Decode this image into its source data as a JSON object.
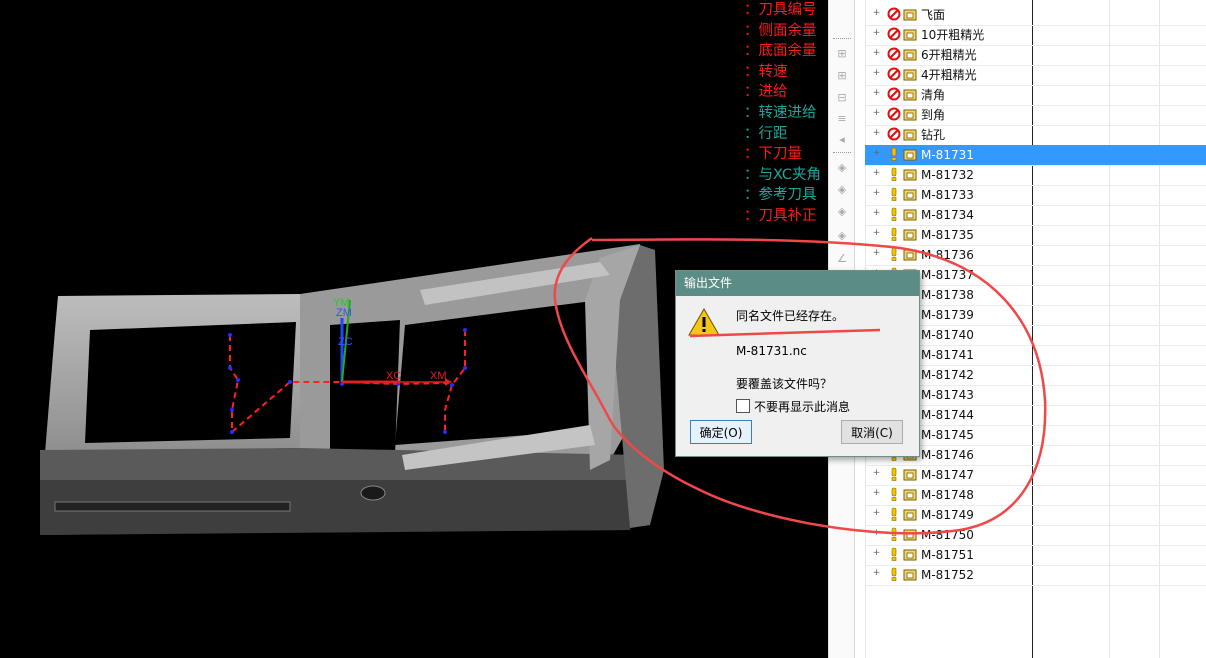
{
  "legend": [
    {
      "text": "：刀具编号",
      "color": "red"
    },
    {
      "text": "：侧面余量",
      "color": "red"
    },
    {
      "text": "：底面余量",
      "color": "red"
    },
    {
      "text": "：转速",
      "color": "red"
    },
    {
      "text": "：进给",
      "color": "red"
    },
    {
      "text": "：转速进给",
      "color": "teal"
    },
    {
      "text": "：行距",
      "color": "teal"
    },
    {
      "text": "：下刀量",
      "color": "red"
    },
    {
      "text": "：与XC夹角",
      "color": "teal"
    },
    {
      "text": "：参考刀具",
      "color": "teal"
    },
    {
      "text": "：刀具补正",
      "color": "red"
    }
  ],
  "axes": {
    "ym": "YM",
    "zm": "ZM",
    "zc": "ZC",
    "xc": "XC",
    "xm": "XM"
  },
  "tree": {
    "rows": [
      {
        "label": "飞面",
        "status": "forbidden"
      },
      {
        "label": "10开粗精光",
        "status": "forbidden"
      },
      {
        "label": "6开粗精光",
        "status": "forbidden"
      },
      {
        "label": "4开粗精光",
        "status": "forbidden"
      },
      {
        "label": "清角",
        "status": "forbidden"
      },
      {
        "label": "到角",
        "status": "forbidden"
      },
      {
        "label": "钻孔",
        "status": "forbidden"
      },
      {
        "label": "M-81731",
        "status": "warning",
        "selected": true
      },
      {
        "label": "M-81732",
        "status": "warning"
      },
      {
        "label": "M-81733",
        "status": "warning"
      },
      {
        "label": "M-81734",
        "status": "warning"
      },
      {
        "label": "M-81735",
        "status": "warning"
      },
      {
        "label": "M-81736",
        "status": "warning"
      },
      {
        "label": "M-81737",
        "status": "warning"
      },
      {
        "label": "M-81738",
        "status": "warning"
      },
      {
        "label": "M-81739",
        "status": "warning"
      },
      {
        "label": "M-81740",
        "status": "warning"
      },
      {
        "label": "M-81741",
        "status": "warning"
      },
      {
        "label": "M-81742",
        "status": "warning"
      },
      {
        "label": "M-81743",
        "status": "warning"
      },
      {
        "label": "M-81744",
        "status": "warning"
      },
      {
        "label": "M-81745",
        "status": "warning"
      },
      {
        "label": "M-81746",
        "status": "warning"
      },
      {
        "label": "M-81747",
        "status": "warning"
      },
      {
        "label": "M-81748",
        "status": "warning"
      },
      {
        "label": "M-81749",
        "status": "warning"
      },
      {
        "label": "M-81750",
        "status": "warning"
      },
      {
        "label": "M-81751",
        "status": "warning"
      },
      {
        "label": "M-81752",
        "status": "warning"
      }
    ]
  },
  "dialog": {
    "title": "输出文件",
    "message": "同名文件已经存在。",
    "filename": "M-81731.nc",
    "question": "要覆盖该文件吗？",
    "checkbox_label": "不要再显示此消息",
    "checkbox_checked": false,
    "ok_label": "确定(O)",
    "cancel_label": "取消(C)"
  },
  "colors": {
    "legend_red": "#ff1a1a",
    "legend_teal": "#1fa69a",
    "selection": "#3399ff",
    "dialog_title": "#5b8d86",
    "annotation": "#f04848",
    "toolpath": "#ff2020"
  }
}
